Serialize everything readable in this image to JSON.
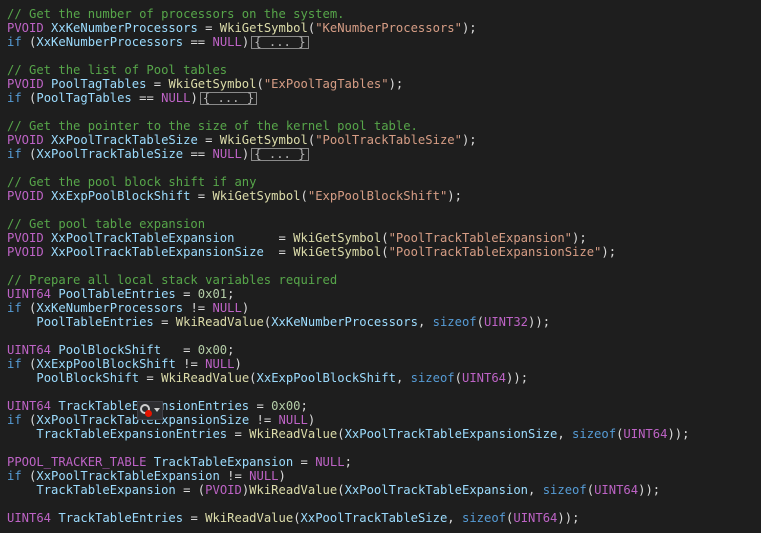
{
  "editor": {
    "lines": [
      [
        {
          "t": "// Get the number of processors on the system.",
          "k": "comment"
        }
      ],
      [
        {
          "t": "PVOID",
          "k": "macro"
        },
        {
          "t": " ",
          "k": "plain"
        },
        {
          "t": "XxKeNumberProcessors",
          "k": "var"
        },
        {
          "t": " = ",
          "k": "plain"
        },
        {
          "t": "WkiGetSymbol",
          "k": "func"
        },
        {
          "t": "(",
          "k": "plain"
        },
        {
          "t": "\"KeNumberProcessors\"",
          "k": "str"
        },
        {
          "t": ");",
          "k": "plain"
        }
      ],
      [
        {
          "t": "if",
          "k": "kw"
        },
        {
          "t": " (",
          "k": "plain"
        },
        {
          "t": "XxKeNumberProcessors",
          "k": "var"
        },
        {
          "t": " == ",
          "k": "plain"
        },
        {
          "t": "NULL",
          "k": "macro"
        },
        {
          "t": ")",
          "k": "plain"
        },
        {
          "t": "{ ... }",
          "k": "fold"
        }
      ],
      [],
      [
        {
          "t": "// Get the list of Pool tables",
          "k": "comment"
        }
      ],
      [
        {
          "t": "PVOID",
          "k": "macro"
        },
        {
          "t": " ",
          "k": "plain"
        },
        {
          "t": "PoolTagTables",
          "k": "var"
        },
        {
          "t": " = ",
          "k": "plain"
        },
        {
          "t": "WkiGetSymbol",
          "k": "func"
        },
        {
          "t": "(",
          "k": "plain"
        },
        {
          "t": "\"ExPoolTagTables\"",
          "k": "str"
        },
        {
          "t": ");",
          "k": "plain"
        }
      ],
      [
        {
          "t": "if",
          "k": "kw"
        },
        {
          "t": " (",
          "k": "plain"
        },
        {
          "t": "PoolTagTables",
          "k": "var"
        },
        {
          "t": " == ",
          "k": "plain"
        },
        {
          "t": "NULL",
          "k": "macro"
        },
        {
          "t": ")",
          "k": "plain"
        },
        {
          "t": "{ ... }",
          "k": "fold"
        }
      ],
      [],
      [
        {
          "t": "// Get the pointer to the size of the kernel pool table.",
          "k": "comment"
        }
      ],
      [
        {
          "t": "PVOID",
          "k": "macro"
        },
        {
          "t": " ",
          "k": "plain"
        },
        {
          "t": "XxPoolTrackTableSize",
          "k": "var"
        },
        {
          "t": " = ",
          "k": "plain"
        },
        {
          "t": "WkiGetSymbol",
          "k": "func"
        },
        {
          "t": "(",
          "k": "plain"
        },
        {
          "t": "\"PoolTrackTableSize\"",
          "k": "str"
        },
        {
          "t": ");",
          "k": "plain"
        }
      ],
      [
        {
          "t": "if",
          "k": "kw"
        },
        {
          "t": " (",
          "k": "plain"
        },
        {
          "t": "XxPoolTrackTableSize",
          "k": "var"
        },
        {
          "t": " == ",
          "k": "plain"
        },
        {
          "t": "NULL",
          "k": "macro"
        },
        {
          "t": ")",
          "k": "plain"
        },
        {
          "t": "{ ... }",
          "k": "fold"
        }
      ],
      [],
      [
        {
          "t": "// Get the pool block shift if any",
          "k": "comment"
        }
      ],
      [
        {
          "t": "PVOID",
          "k": "macro"
        },
        {
          "t": " ",
          "k": "plain"
        },
        {
          "t": "XxExpPoolBlockShift",
          "k": "var"
        },
        {
          "t": " = ",
          "k": "plain"
        },
        {
          "t": "WkiGetSymbol",
          "k": "func"
        },
        {
          "t": "(",
          "k": "plain"
        },
        {
          "t": "\"ExpPoolBlockShift\"",
          "k": "str"
        },
        {
          "t": ");",
          "k": "plain"
        }
      ],
      [],
      [
        {
          "t": "// Get pool table expansion",
          "k": "comment"
        }
      ],
      [
        {
          "t": "PVOID",
          "k": "macro"
        },
        {
          "t": " ",
          "k": "plain"
        },
        {
          "t": "XxPoolTrackTableExpansion",
          "k": "var"
        },
        {
          "t": "      = ",
          "k": "plain"
        },
        {
          "t": "WkiGetSymbol",
          "k": "func"
        },
        {
          "t": "(",
          "k": "plain"
        },
        {
          "t": "\"PoolTrackTableExpansion\"",
          "k": "str"
        },
        {
          "t": ");",
          "k": "plain"
        }
      ],
      [
        {
          "t": "PVOID",
          "k": "macro"
        },
        {
          "t": " ",
          "k": "plain"
        },
        {
          "t": "XxPoolTrackTableExpansionSize",
          "k": "var"
        },
        {
          "t": "  = ",
          "k": "plain"
        },
        {
          "t": "WkiGetSymbol",
          "k": "func"
        },
        {
          "t": "(",
          "k": "plain"
        },
        {
          "t": "\"PoolTrackTableExpansionSize\"",
          "k": "str"
        },
        {
          "t": ");",
          "k": "plain"
        }
      ],
      [],
      [
        {
          "t": "// Prepare all local stack variables required",
          "k": "comment"
        }
      ],
      [
        {
          "t": "UINT64",
          "k": "macro"
        },
        {
          "t": " ",
          "k": "plain"
        },
        {
          "t": "PoolTableEntries",
          "k": "var"
        },
        {
          "t": " = ",
          "k": "plain"
        },
        {
          "t": "0x01",
          "k": "num"
        },
        {
          "t": ";",
          "k": "plain"
        }
      ],
      [
        {
          "t": "if",
          "k": "kw"
        },
        {
          "t": " (",
          "k": "plain"
        },
        {
          "t": "XxKeNumberProcessors",
          "k": "var"
        },
        {
          "t": " != ",
          "k": "plain"
        },
        {
          "t": "NULL",
          "k": "macro"
        },
        {
          "t": ")",
          "k": "plain"
        }
      ],
      [
        {
          "t": "    ",
          "k": "plain"
        },
        {
          "t": "PoolTableEntries",
          "k": "var"
        },
        {
          "t": " = ",
          "k": "plain"
        },
        {
          "t": "WkiReadValue",
          "k": "func"
        },
        {
          "t": "(",
          "k": "plain"
        },
        {
          "t": "XxKeNumberProcessors",
          "k": "var"
        },
        {
          "t": ", ",
          "k": "plain"
        },
        {
          "t": "sizeof",
          "k": "kw"
        },
        {
          "t": "(",
          "k": "plain"
        },
        {
          "t": "UINT32",
          "k": "macro"
        },
        {
          "t": "));",
          "k": "plain"
        }
      ],
      [],
      [
        {
          "t": "UINT64",
          "k": "macro"
        },
        {
          "t": " ",
          "k": "plain"
        },
        {
          "t": "PoolBlockShift",
          "k": "var"
        },
        {
          "t": "   = ",
          "k": "plain"
        },
        {
          "t": "0x00",
          "k": "num"
        },
        {
          "t": ";",
          "k": "plain"
        }
      ],
      [
        {
          "t": "if",
          "k": "kw"
        },
        {
          "t": " (",
          "k": "plain"
        },
        {
          "t": "XxExpPoolBlockShift",
          "k": "var"
        },
        {
          "t": " != ",
          "k": "plain"
        },
        {
          "t": "NULL",
          "k": "macro"
        },
        {
          "t": ")",
          "k": "plain"
        }
      ],
      [
        {
          "t": "    ",
          "k": "plain"
        },
        {
          "t": "PoolBlockShift",
          "k": "var"
        },
        {
          "t": " = ",
          "k": "plain"
        },
        {
          "t": "WkiReadValue",
          "k": "func"
        },
        {
          "t": "(",
          "k": "plain"
        },
        {
          "t": "XxExpPoolBlockShift",
          "k": "var"
        },
        {
          "t": ", ",
          "k": "plain"
        },
        {
          "t": "sizeof",
          "k": "kw"
        },
        {
          "t": "(",
          "k": "plain"
        },
        {
          "t": "UINT64",
          "k": "macro"
        },
        {
          "t": "));",
          "k": "plain"
        }
      ],
      [],
      [
        {
          "t": "UINT64",
          "k": "macro"
        },
        {
          "t": " ",
          "k": "plain"
        },
        {
          "t": "TrackTableExpansionEntries",
          "k": "var"
        },
        {
          "t": " = ",
          "k": "plain"
        },
        {
          "t": "0x00",
          "k": "num"
        },
        {
          "t": ";",
          "k": "plain"
        }
      ],
      [
        {
          "t": "if",
          "k": "kw"
        },
        {
          "t": " (",
          "k": "plain"
        },
        {
          "t": "XxPoolTrackTableExpansionSize",
          "k": "var"
        },
        {
          "t": " != ",
          "k": "plain"
        },
        {
          "t": "NULL",
          "k": "macro"
        },
        {
          "t": ")",
          "k": "plain"
        }
      ],
      [
        {
          "t": "    ",
          "k": "plain"
        },
        {
          "t": "TrackTableExpansionEntries",
          "k": "var"
        },
        {
          "t": " = ",
          "k": "plain"
        },
        {
          "t": "WkiReadValue",
          "k": "func"
        },
        {
          "t": "(",
          "k": "plain"
        },
        {
          "t": "XxPoolTrackTableExpansionSize",
          "k": "var"
        },
        {
          "t": ", ",
          "k": "plain"
        },
        {
          "t": "sizeof",
          "k": "kw"
        },
        {
          "t": "(",
          "k": "plain"
        },
        {
          "t": "UINT64",
          "k": "macro"
        },
        {
          "t": "));",
          "k": "plain"
        }
      ],
      [],
      [
        {
          "t": "PPOOL_TRACKER_TABLE",
          "k": "macro"
        },
        {
          "t": " ",
          "k": "plain"
        },
        {
          "t": "TrackTableExpansion",
          "k": "var"
        },
        {
          "t": " = ",
          "k": "plain"
        },
        {
          "t": "NULL",
          "k": "macro"
        },
        {
          "t": ";",
          "k": "plain"
        }
      ],
      [
        {
          "t": "if",
          "k": "kw"
        },
        {
          "t": " (",
          "k": "plain"
        },
        {
          "t": "XxPoolTrackTableExpansion",
          "k": "var"
        },
        {
          "t": " != ",
          "k": "plain"
        },
        {
          "t": "NULL",
          "k": "macro"
        },
        {
          "t": ")",
          "k": "plain"
        }
      ],
      [
        {
          "t": "    ",
          "k": "plain"
        },
        {
          "t": "TrackTableExpansion",
          "k": "var"
        },
        {
          "t": " = ",
          "k": "plain"
        },
        {
          "t": "(",
          "k": "plain"
        },
        {
          "t": "PVOID",
          "k": "macro"
        },
        {
          "t": ")",
          "k": "plain"
        },
        {
          "t": "WkiReadValue",
          "k": "func"
        },
        {
          "t": "(",
          "k": "plain"
        },
        {
          "t": "XxPoolTrackTableExpansion",
          "k": "var"
        },
        {
          "t": ", ",
          "k": "plain"
        },
        {
          "t": "sizeof",
          "k": "kw"
        },
        {
          "t": "(",
          "k": "plain"
        },
        {
          "t": "UINT64",
          "k": "macro"
        },
        {
          "t": "));",
          "k": "plain"
        }
      ],
      [],
      [
        {
          "t": "UINT64",
          "k": "macro"
        },
        {
          "t": " ",
          "k": "plain"
        },
        {
          "t": "TrackTableEntries",
          "k": "var"
        },
        {
          "t": " = ",
          "k": "plain"
        },
        {
          "t": "WkiReadValue",
          "k": "func"
        },
        {
          "t": "(",
          "k": "plain"
        },
        {
          "t": "XxPoolTrackTableSize",
          "k": "var"
        },
        {
          "t": ", ",
          "k": "plain"
        },
        {
          "t": "sizeof",
          "k": "kw"
        },
        {
          "t": "(",
          "k": "plain"
        },
        {
          "t": "UINT64",
          "k": "macro"
        },
        {
          "t": "));",
          "k": "plain"
        }
      ]
    ]
  },
  "quick_actions": {
    "icon": "lightbulb-error-icon",
    "dropdown_icon": "chevron-down-icon"
  },
  "colors": {
    "background": "#1e1e1e",
    "comment": "#57a64a",
    "macro": "#bd63c5",
    "variable": "#9cdcfe",
    "function": "#dcdcaa",
    "string": "#d69d85",
    "keyword": "#569cd6",
    "number": "#b5cea8",
    "plain": "#dcdcdc"
  }
}
